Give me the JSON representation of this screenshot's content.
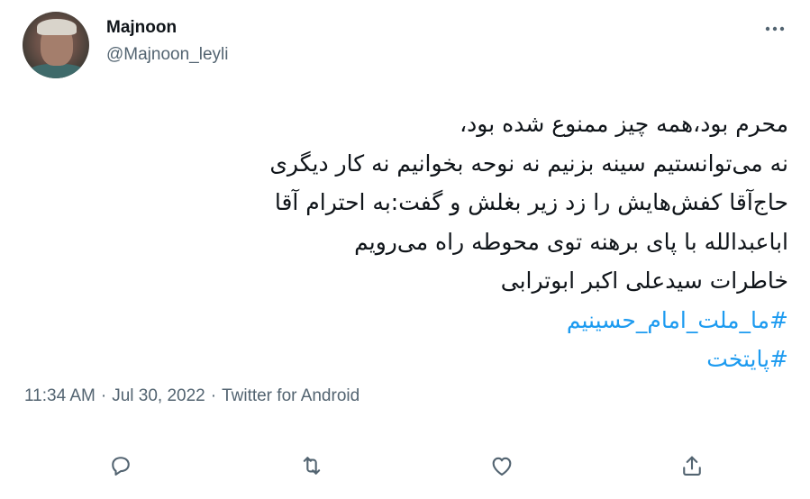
{
  "author": {
    "display_name": "Majnoon",
    "handle": "@Majnoon_leyli"
  },
  "tweet": {
    "lines": [
      "محرم بود،همه چیز ممنوع شده بود،",
      "نه می‌توانستیم سینه بزنیم نه نوحه بخوانیم نه کار دیگری",
      "حاج‌آقا کفش‌هایش را زد زیر بغلش و گفت:به احترام آقا",
      "اباعبدالله با پای برهنه توی محوطه راه می‌رویم",
      "خاطرات سیدعلی اکبر ابوترابی"
    ],
    "hashtags": [
      "#ما_ملت_امام_حسینیم",
      "#پایتخت"
    ]
  },
  "meta": {
    "time": "11:34 AM",
    "separator": "·",
    "date": "Jul 30, 2022",
    "source": "Twitter for Android"
  },
  "icons": {
    "more": "more-dots-icon",
    "reply": "reply-icon",
    "retweet": "retweet-icon",
    "like": "like-icon",
    "share": "share-icon"
  },
  "colors": {
    "text": "#0f1419",
    "secondary": "#536471",
    "link": "#1d9bf0"
  }
}
